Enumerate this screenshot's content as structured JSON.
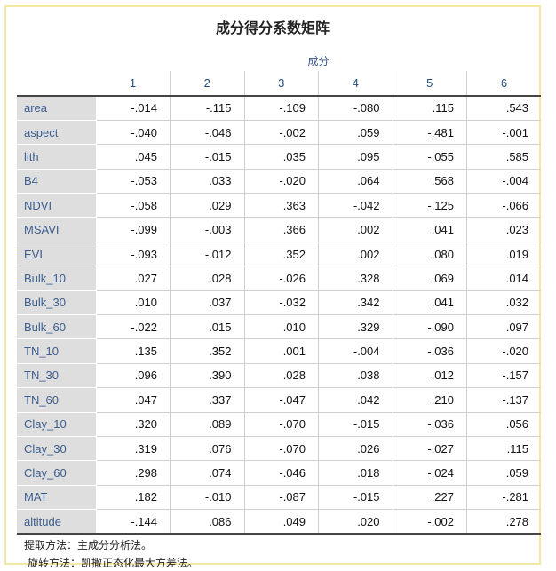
{
  "title": "成分得分系数矩阵",
  "column_group": "成分",
  "columns": [
    "1",
    "2",
    "3",
    "4",
    "5",
    "6"
  ],
  "rows": [
    {
      "label": "area",
      "values": [
        "-.014",
        "-.115",
        "-.109",
        "-.080",
        ".115",
        ".543"
      ]
    },
    {
      "label": "aspect",
      "values": [
        "-.040",
        "-.046",
        "-.002",
        ".059",
        "-.481",
        "-.001"
      ]
    },
    {
      "label": "lith",
      "values": [
        ".045",
        "-.015",
        ".035",
        ".095",
        "-.055",
        ".585"
      ]
    },
    {
      "label": "B4",
      "values": [
        "-.053",
        ".033",
        "-.020",
        ".064",
        ".568",
        "-.004"
      ]
    },
    {
      "label": "NDVI",
      "values": [
        "-.058",
        ".029",
        ".363",
        "-.042",
        "-.125",
        "-.066"
      ]
    },
    {
      "label": "MSAVI",
      "values": [
        "-.099",
        "-.003",
        ".366",
        ".002",
        ".041",
        ".023"
      ]
    },
    {
      "label": "EVI",
      "values": [
        "-.093",
        "-.012",
        ".352",
        ".002",
        ".080",
        ".019"
      ]
    },
    {
      "label": "Bulk_10",
      "values": [
        ".027",
        ".028",
        "-.026",
        ".328",
        ".069",
        ".014"
      ]
    },
    {
      "label": "Bulk_30",
      "values": [
        ".010",
        ".037",
        "-.032",
        ".342",
        ".041",
        ".032"
      ]
    },
    {
      "label": "Bulk_60",
      "values": [
        "-.022",
        ".015",
        ".010",
        ".329",
        "-.090",
        ".097"
      ]
    },
    {
      "label": "TN_10",
      "values": [
        ".135",
        ".352",
        ".001",
        "-.004",
        "-.036",
        "-.020"
      ]
    },
    {
      "label": "TN_30",
      "values": [
        ".096",
        ".390",
        ".028",
        ".038",
        ".012",
        "-.157"
      ]
    },
    {
      "label": "TN_60",
      "values": [
        ".047",
        ".337",
        "-.047",
        ".042",
        ".210",
        "-.137"
      ]
    },
    {
      "label": "Clay_10",
      "values": [
        ".320",
        ".089",
        "-.070",
        "-.015",
        "-.036",
        ".056"
      ]
    },
    {
      "label": "Clay_30",
      "values": [
        ".319",
        ".076",
        "-.070",
        ".026",
        "-.027",
        ".115"
      ]
    },
    {
      "label": "Clay_60",
      "values": [
        ".298",
        ".074",
        "-.046",
        ".018",
        "-.024",
        ".059"
      ]
    },
    {
      "label": "MAT",
      "values": [
        ".182",
        "-.010",
        "-.087",
        "-.015",
        ".227",
        "-.281"
      ]
    },
    {
      "label": "altitude",
      "values": [
        "-.144",
        ".086",
        ".049",
        ".020",
        "-.002",
        ".278"
      ]
    }
  ],
  "footnotes": [
    "提取方法：主成分分析法。",
    "旋转方法：凯撒正态化最大方差法。"
  ],
  "colors": {
    "frame_border": "#f3e7a1",
    "header_text": "#234c80",
    "label_bg": "#dedede",
    "label_text": "#3b5d8f"
  }
}
